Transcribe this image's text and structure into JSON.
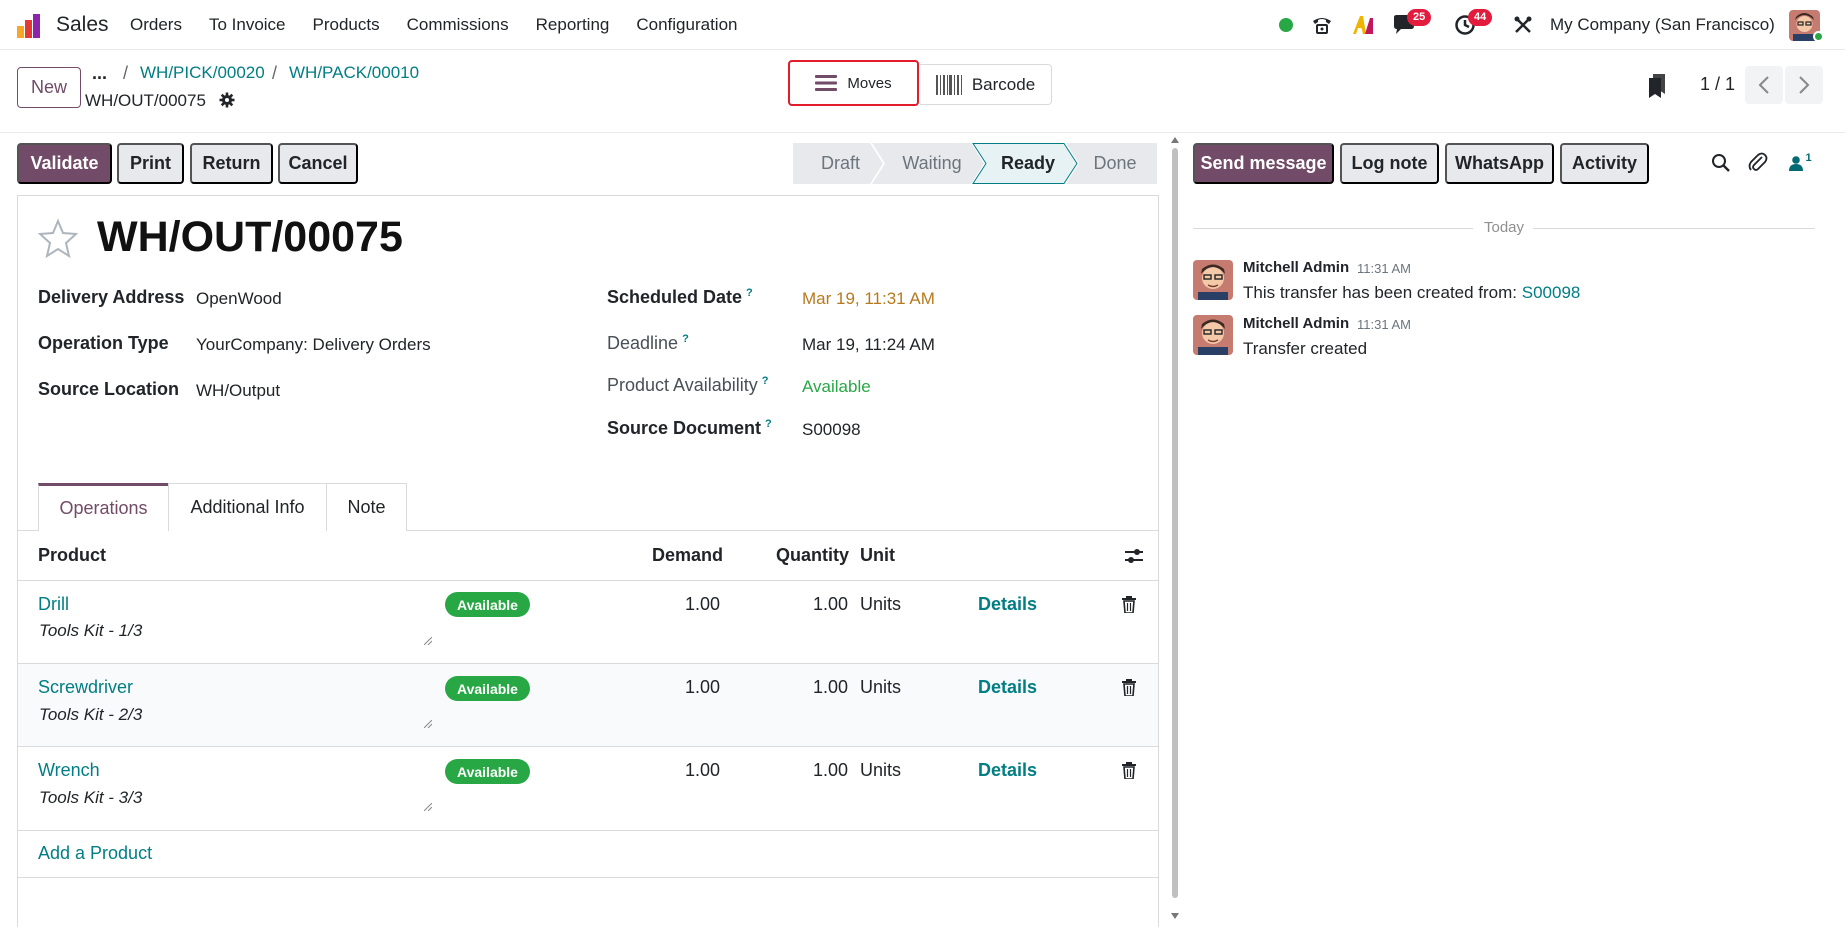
{
  "app": {
    "name": "Sales",
    "icon": "sales-app-logo"
  },
  "menu": {
    "items": [
      "Orders",
      "To Invoice",
      "Products",
      "Commissions",
      "Reporting",
      "Configuration"
    ]
  },
  "systray": {
    "chat_badge": "25",
    "activity_badge": "44",
    "company": "My Company (San Francisco)",
    "icons": [
      "status-online-icon",
      "phone-icon",
      "ai-icon",
      "chat-icon",
      "activity-clock-icon",
      "debug-tools-icon"
    ]
  },
  "control": {
    "new_label": "New",
    "ellipsis": "...",
    "breadcrumbs": [
      "WH/PICK/00020",
      "WH/PACK/00010"
    ],
    "record": "WH/OUT/00075",
    "moves_label": "Moves",
    "barcode_label": "Barcode",
    "pager": "1 / 1"
  },
  "actions": {
    "validate": "Validate",
    "print": "Print",
    "return": "Return",
    "cancel": "Cancel"
  },
  "statusbar": {
    "stages": [
      "Draft",
      "Waiting",
      "Ready",
      "Done"
    ],
    "active": "Ready"
  },
  "form": {
    "title": "WH/OUT/00075",
    "left_fields": [
      {
        "label": "Delivery Address",
        "value": "OpenWood"
      },
      {
        "label": "Operation Type",
        "value": "YourCompany: Delivery Orders"
      },
      {
        "label": "Source Location",
        "value": "WH/Output"
      }
    ],
    "scheduled_date": {
      "label": "Scheduled Date",
      "value": "Mar 19, 11:31 AM",
      "color": "#b7791f"
    },
    "deadline": {
      "label": "Deadline",
      "value": "Mar 19, 11:24 AM"
    },
    "availability": {
      "label": "Product Availability",
      "value": "Available",
      "color": "#28a745"
    },
    "source_document": {
      "label": "Source Document",
      "value": "S00098"
    },
    "help_mark": "?"
  },
  "tabs": [
    "Operations",
    "Additional Info",
    "Note"
  ],
  "operations": {
    "columns": {
      "product": "Product",
      "demand": "Demand",
      "quantity": "Quantity",
      "unit": "Unit"
    },
    "rows": [
      {
        "product": "Drill",
        "description": "Tools Kit - 1/3",
        "status": "Available",
        "demand": "1.00",
        "quantity": "1.00",
        "unit": "Units",
        "details": "Details"
      },
      {
        "product": "Screwdriver",
        "description": "Tools Kit - 2/3",
        "status": "Available",
        "demand": "1.00",
        "quantity": "1.00",
        "unit": "Units",
        "details": "Details"
      },
      {
        "product": "Wrench",
        "description": "Tools Kit - 3/3",
        "status": "Available",
        "demand": "1.00",
        "quantity": "1.00",
        "unit": "Units",
        "details": "Details"
      }
    ],
    "add_product": "Add a Product"
  },
  "chatter": {
    "send_message": "Send message",
    "log_note": "Log note",
    "whatsapp": "WhatsApp",
    "activity": "Activity",
    "followers_count": "1",
    "separator": "Today",
    "messages": [
      {
        "author": "Mitchell Admin",
        "time": "11:31 AM",
        "body": "This transfer has been created from: ",
        "link": "S00098"
      },
      {
        "author": "Mitchell Admin",
        "time": "11:31 AM",
        "body": "Transfer created",
        "link": ""
      }
    ]
  },
  "colors": {
    "primary": "#714b67",
    "link": "#017e84",
    "success": "#28a745",
    "danger": "#e31b3c"
  }
}
